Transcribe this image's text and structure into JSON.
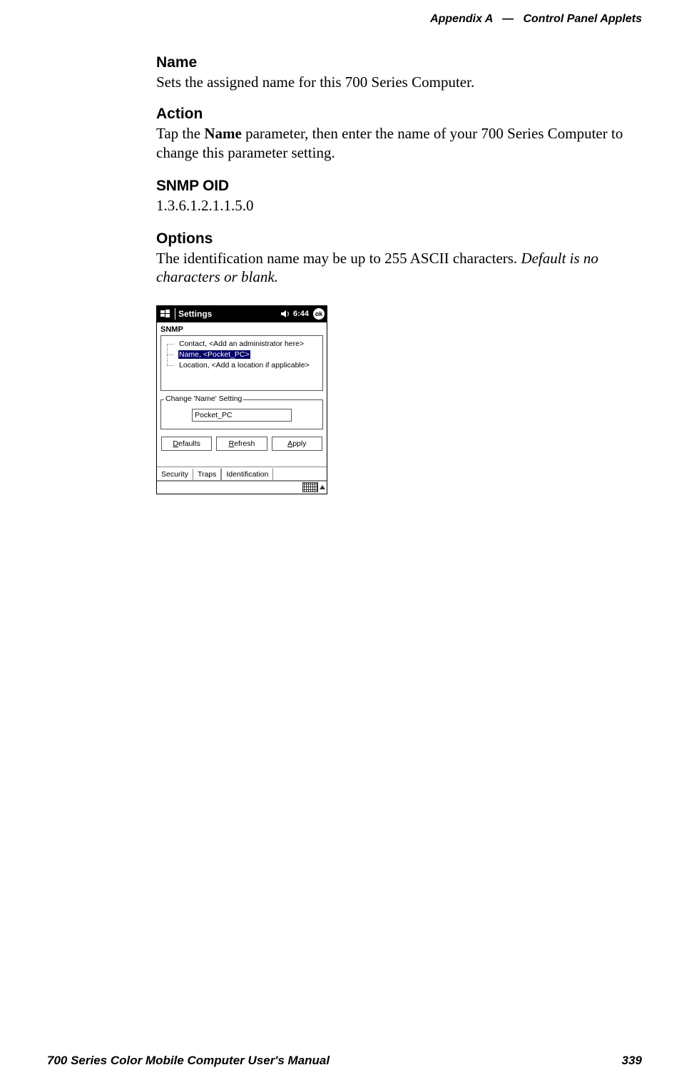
{
  "header": {
    "appendix": "Appendix A",
    "separator": "—",
    "title": "Control Panel Applets"
  },
  "sections": {
    "name": {
      "heading": "Name",
      "body": "Sets the assigned name for this 700 Series Computer."
    },
    "action": {
      "heading": "Action",
      "pre": "Tap the ",
      "bold": "Name",
      "post": " parameter, then enter the name of your 700 Series Computer to change this parameter setting."
    },
    "snmp": {
      "heading": "SNMP OID",
      "body": "1.3.6.1.2.1.1.5.0"
    },
    "options": {
      "heading": "Options",
      "pre": "The identification name may be up to 255 ASCII characters. ",
      "italic": "Default is no characters or blank."
    }
  },
  "device": {
    "header_title": "Settings",
    "clock": "6:44",
    "ok": "ok",
    "applet_title": "SNMP",
    "tree": {
      "row1": "Contact, <Add an administrator here>",
      "row2": "Name, <Pocket_PC>",
      "row3": "Location, <Add a location if applicable>"
    },
    "fieldset_legend": "Change 'Name' Setting",
    "input_value": "Pocket_PC",
    "buttons": {
      "defaults_ul": "D",
      "defaults_rest": "efaults",
      "refresh_ul": "R",
      "refresh_rest": "efresh",
      "apply_ul": "A",
      "apply_rest": "pply"
    },
    "tabs": {
      "t1": "Security",
      "t2": "Traps",
      "t3": "Identification"
    }
  },
  "footer": {
    "manual": "700 Series Color Mobile Computer User's Manual",
    "page": "339"
  }
}
